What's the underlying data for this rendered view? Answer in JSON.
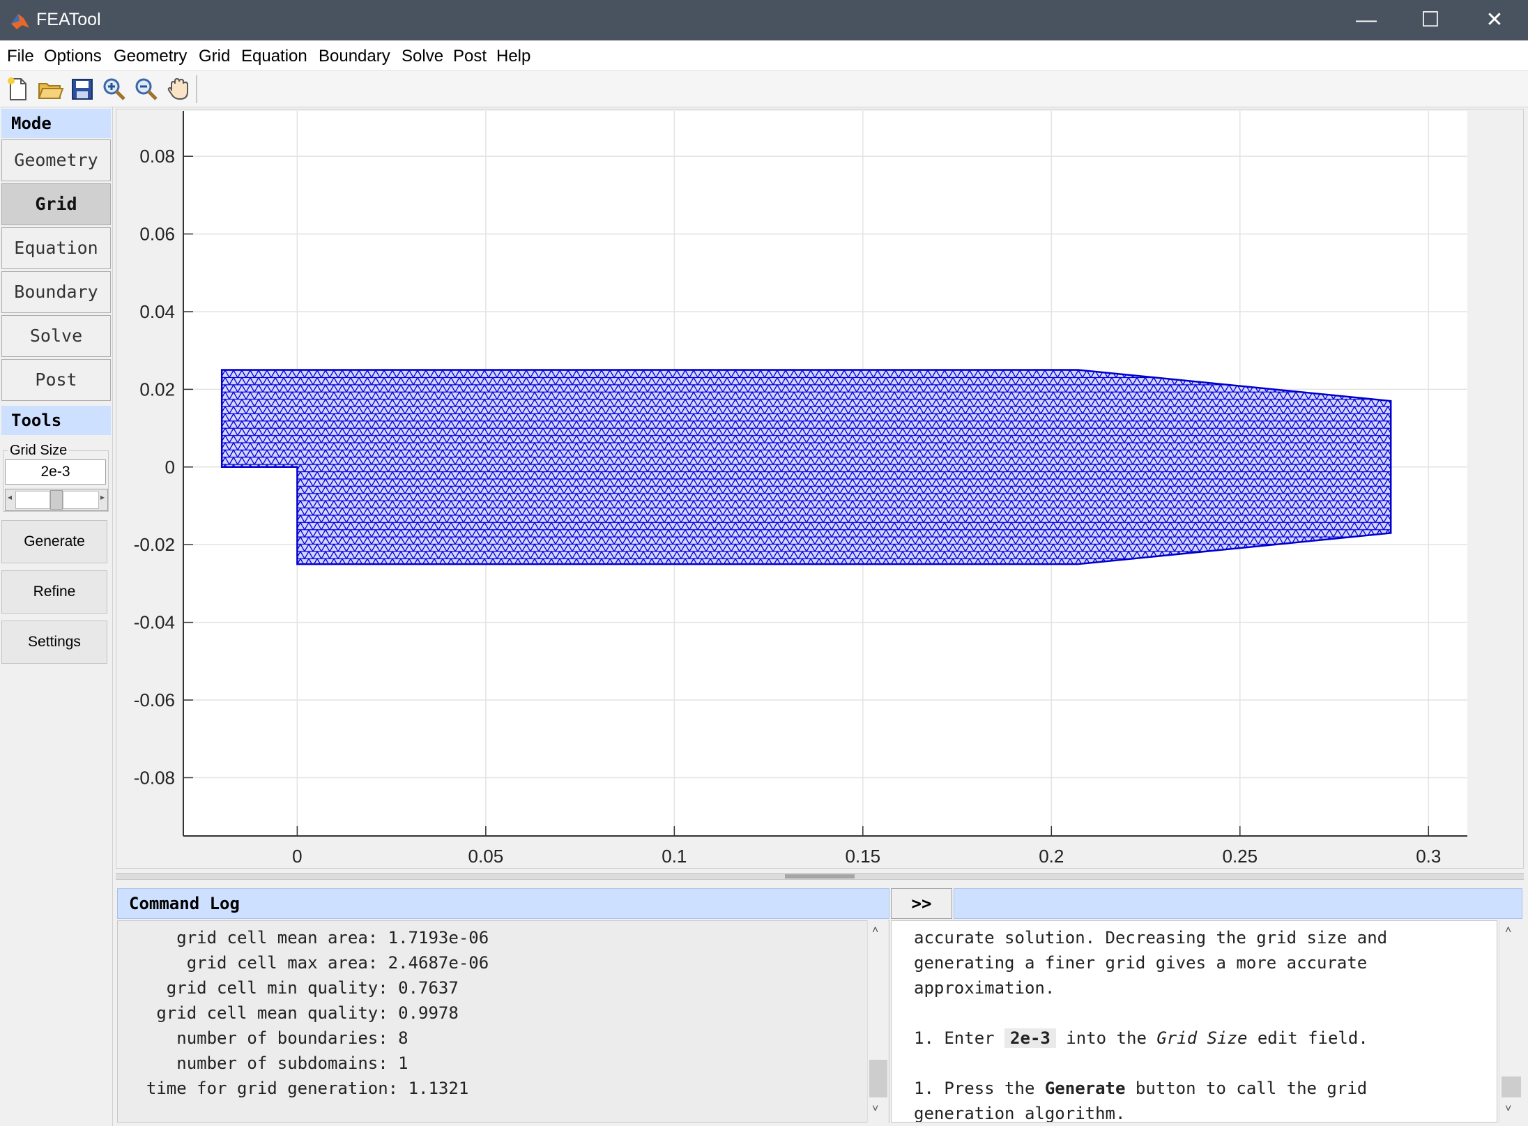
{
  "window": {
    "title": "FEATool",
    "minimize": "—",
    "maximize": "☐",
    "close": "✕"
  },
  "menu": [
    "File",
    "Options",
    "Geometry",
    "Grid",
    "Equation",
    "Boundary",
    "Solve",
    "Post",
    "Help"
  ],
  "toolbar": {
    "icons": [
      "new-file-icon",
      "open-folder-icon",
      "save-icon",
      "zoom-in-icon",
      "zoom-out-icon",
      "pan-hand-icon"
    ]
  },
  "sidebar": {
    "mode_header": "Mode",
    "modes": [
      {
        "label": "Geometry",
        "active": false
      },
      {
        "label": "Grid",
        "active": true
      },
      {
        "label": "Equation",
        "active": false
      },
      {
        "label": "Boundary",
        "active": false
      },
      {
        "label": "Solve",
        "active": false
      },
      {
        "label": "Post",
        "active": false
      }
    ],
    "tools_header": "Tools",
    "grid_size_label": "Grid Size",
    "grid_size_value": "2e-3",
    "buttons": [
      "Generate",
      "Refine",
      "Settings"
    ]
  },
  "plot": {
    "x_ticks": [
      "0",
      "0.05",
      "0.1",
      "0.15",
      "0.2",
      "0.25",
      "0.3"
    ],
    "y_ticks": [
      "0.08",
      "0.06",
      "0.04",
      "0.02",
      "0",
      "-0.02",
      "-0.04",
      "-0.06",
      "-0.08"
    ],
    "mesh_color": "#1a1ad6",
    "mesh_edge_color": "#0000cc",
    "geometry_outline": [
      [
        -0.02,
        0
      ],
      [
        -0.02,
        0.025
      ],
      [
        0.207,
        0.025
      ],
      [
        0.29,
        0.017
      ],
      [
        0.29,
        -0.017
      ],
      [
        0.207,
        -0.025
      ],
      [
        0,
        -0.025
      ],
      [
        0,
        0
      ]
    ]
  },
  "command_log": {
    "header": "Command Log",
    "lines": [
      "     grid cell mean area: 1.7193e-06",
      "      grid cell max area: 2.4687e-06",
      "    grid cell min quality: 0.7637",
      "   grid cell mean quality: 0.9978",
      "     number of boundaries: 8",
      "     number of subdomains: 1",
      "  time for grid generation: 1.1321"
    ]
  },
  "expand_button": ">>",
  "help": {
    "line1": "accurate solution. Decreasing the grid size and",
    "line2": "generating a finer grid gives a more accurate",
    "line3": "approximation.",
    "step1_prefix": "1. Enter ",
    "step1_code": "2e-3",
    "step1_mid": " into the ",
    "step1_em": "Grid Size",
    "step1_suffix": " edit field.",
    "step2_prefix": "1. Press the ",
    "step2_bold": "Generate",
    "step2_suffix": " button to call the grid",
    "step2_line2": "generation algorithm."
  }
}
